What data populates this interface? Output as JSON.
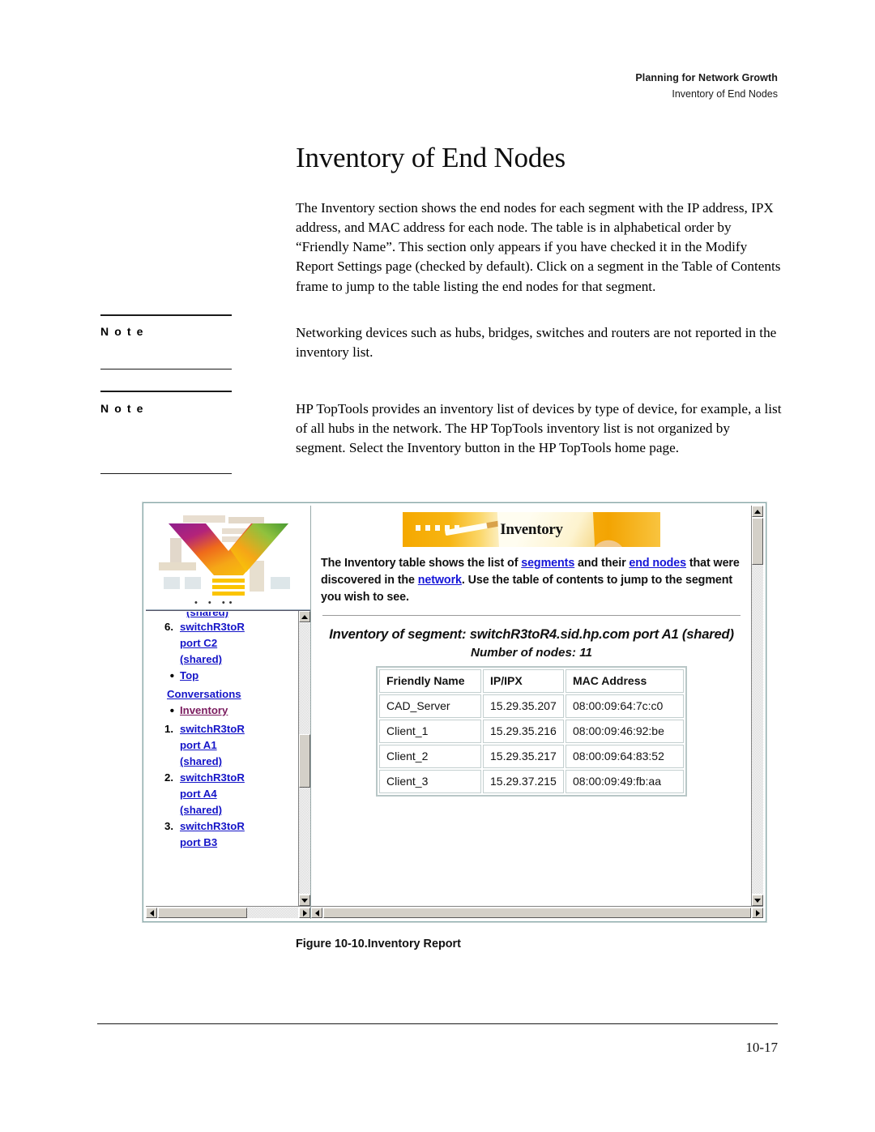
{
  "header": {
    "chapter": "Planning for Network Growth",
    "section": "Inventory of End Nodes"
  },
  "page_title": "Inventory of End Nodes",
  "intro_paragraph": "The Inventory section shows the end nodes for each segment with the IP address, IPX address, and MAC address for each node. The table is in alphabetical order by “Friendly Name”. This section only appears if you have checked it in the Modify Report Settings page (checked by default). Click on a segment in the Table of Contents frame to jump to the table listing the end nodes for that segment.",
  "notes": [
    {
      "label": "N o t e",
      "text": "Networking devices such as hubs, bridges, switches and routers are not reported in the inventory list."
    },
    {
      "label": "N o t e",
      "text": "HP TopTools provides an inventory list of devices by type of device, for example, a list of all hubs in the network. The HP TopTools inventory list is not organized by segment. Select the Inventory button in the HP TopTools home page."
    }
  ],
  "figure": {
    "caption": "Figure 10-10.Inventory Report",
    "nav_pane": {
      "items": [
        {
          "marker": "",
          "text": "(shared)",
          "type": "cut",
          "visited": false
        },
        {
          "marker": "6.",
          "text": "switchR3toR",
          "type": "numbered",
          "visited": false
        },
        {
          "marker": "",
          "text": "port C2",
          "type": "cont",
          "visited": false
        },
        {
          "marker": "",
          "text": "(shared)",
          "type": "cont",
          "visited": false
        },
        {
          "marker": "•",
          "text": "Top",
          "type": "bullet",
          "visited": false
        },
        {
          "marker": "",
          "text": "Conversations",
          "type": "cont-wide",
          "visited": false
        },
        {
          "marker": "•",
          "text": "Inventory",
          "type": "bullet",
          "visited": true
        },
        {
          "marker": "1.",
          "text": "switchR3toR",
          "type": "numbered",
          "visited": false
        },
        {
          "marker": "",
          "text": "port A1",
          "type": "cont",
          "visited": false
        },
        {
          "marker": "",
          "text": "(shared)",
          "type": "cont",
          "visited": false
        },
        {
          "marker": "2.",
          "text": "switchR3toR",
          "type": "numbered",
          "visited": false
        },
        {
          "marker": "",
          "text": "port A4",
          "type": "cont",
          "visited": false
        },
        {
          "marker": "",
          "text": "(shared)",
          "type": "cont",
          "visited": false
        },
        {
          "marker": "3.",
          "text": "switchR3toR",
          "type": "numbered",
          "visited": false
        },
        {
          "marker": "",
          "text": "port B3",
          "type": "cont",
          "visited": false
        }
      ]
    },
    "content_pane": {
      "banner_title": "Inventory",
      "description_parts": [
        {
          "text": "The Inventory table shows the list of ",
          "link": false
        },
        {
          "text": "segments",
          "link": true
        },
        {
          "text": " and their ",
          "link": false
        },
        {
          "text": "end nodes",
          "link": true
        },
        {
          "text": " that were discovered in the ",
          "link": false
        },
        {
          "text": "network",
          "link": true
        },
        {
          "text": ". Use the table of contents to jump to the segment you wish to see.",
          "link": false
        }
      ],
      "segment_title": "Inventory of segment: switchR3toR4.sid.hp.com port A1 (shared)",
      "node_count_label": "Number of nodes: 11",
      "table": {
        "columns": [
          "Friendly Name",
          "IP/IPX",
          "MAC Address"
        ],
        "rows": [
          [
            "CAD_Server",
            "15.29.35.207",
            "08:00:09:64:7c:c0"
          ],
          [
            "Client_1",
            "15.29.35.216",
            "08:00:09:46:92:be"
          ],
          [
            "Client_2",
            "15.29.35.217",
            "08:00:09:64:83:52"
          ],
          [
            "Client_3",
            "15.29.37.215",
            "08:00:09:49:fb:aa"
          ]
        ]
      }
    }
  },
  "page_number": "10-17",
  "colors": {
    "link": "#1515d8",
    "visited_link": "#7a1b5e",
    "banner_accent": "#f5a800",
    "scrollbar_face": "#d4d0c8"
  }
}
